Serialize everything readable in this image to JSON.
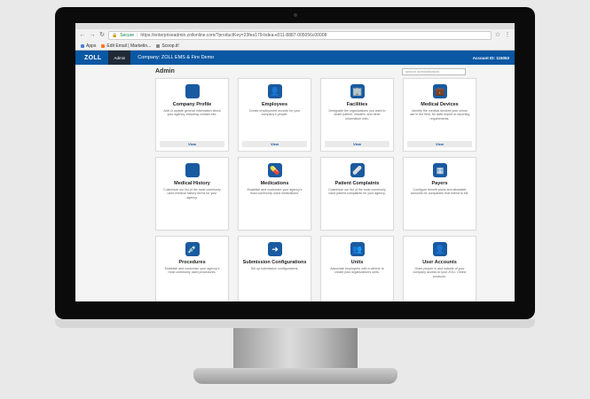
{
  "browser": {
    "secure_label": "Secure",
    "url": "https://enterpriseadmin.zollonline.com/?productKey=23fea179-bdea-e011-8887-005056c00008",
    "bookmarks": [
      {
        "label": "Apps",
        "icon": "apps-grid-icon",
        "color": "#4a7fd6"
      },
      {
        "label": "Edit Email | Marketin...",
        "icon": "hubspot-icon",
        "color": "#f57722"
      },
      {
        "label": "Scoop.it!",
        "icon": "page-icon",
        "color": "#888888"
      }
    ]
  },
  "header": {
    "logo": "ZOLL",
    "admin_tab": "Admin",
    "company": "Company: ZOLL EMS & Fire Demo",
    "account": "Account ID: 115053",
    "brand_color": "#0a57a3"
  },
  "page": {
    "title": "Admin",
    "search_placeholder": "search administration"
  },
  "cards": [
    {
      "title": "Company Profile",
      "icon": "company-icon",
      "glyph": "",
      "desc": "Add or update general information about your agency, including contact info.",
      "view": "View"
    },
    {
      "title": "Employees",
      "icon": "employee-icon",
      "glyph": "👤",
      "desc": "Create employment records for your company's people.",
      "view": "View"
    },
    {
      "title": "Facilities",
      "icon": "facility-icon",
      "glyph": "🏢",
      "desc": "Designate the organizations you want to share patient, incident, and other information with.",
      "view": "View"
    },
    {
      "title": "Medical Devices",
      "icon": "medical-device-icon",
      "glyph": "💼",
      "desc": "Identify the medical devices your crews use in the field, for data import or reporting requirements.",
      "view": "View"
    },
    {
      "title": "Medical History",
      "icon": "medical-history-icon",
      "glyph": "",
      "desc": "Customize our list of the most commonly used medical history terms for your agency.",
      "view": ""
    },
    {
      "title": "Medications",
      "icon": "medications-icon",
      "glyph": "💊",
      "desc": "Establish and customize your agency's most commonly used medications.",
      "view": ""
    },
    {
      "title": "Patient Complaints",
      "icon": "bandage-icon",
      "glyph": "🩹",
      "desc": "Customize our list of the most commonly used patient complaints for your agency.",
      "view": ""
    },
    {
      "title": "Payers",
      "icon": "calculator-icon",
      "glyph": "▦",
      "desc": "Configure benefit plans and allowable amounts for companies that intend to bill.",
      "view": ""
    },
    {
      "title": "Procedures",
      "icon": "syringe-icon",
      "glyph": "💉",
      "desc": "Establish and customize your agency's most commonly used procedures.",
      "view": ""
    },
    {
      "title": "Submission Configurations",
      "icon": "submission-icon",
      "glyph": "➜",
      "desc": "Set up submission configurations.",
      "view": ""
    },
    {
      "title": "Units",
      "icon": "unit-icon",
      "glyph": "👥",
      "desc": "Associate employees with a vehicle to create your organization's units.",
      "view": ""
    },
    {
      "title": "User Accounts",
      "icon": "user-account-icon",
      "glyph": "👤",
      "desc": "Grant people in and outside of your company access to your ZOLL Online products.",
      "view": ""
    }
  ]
}
